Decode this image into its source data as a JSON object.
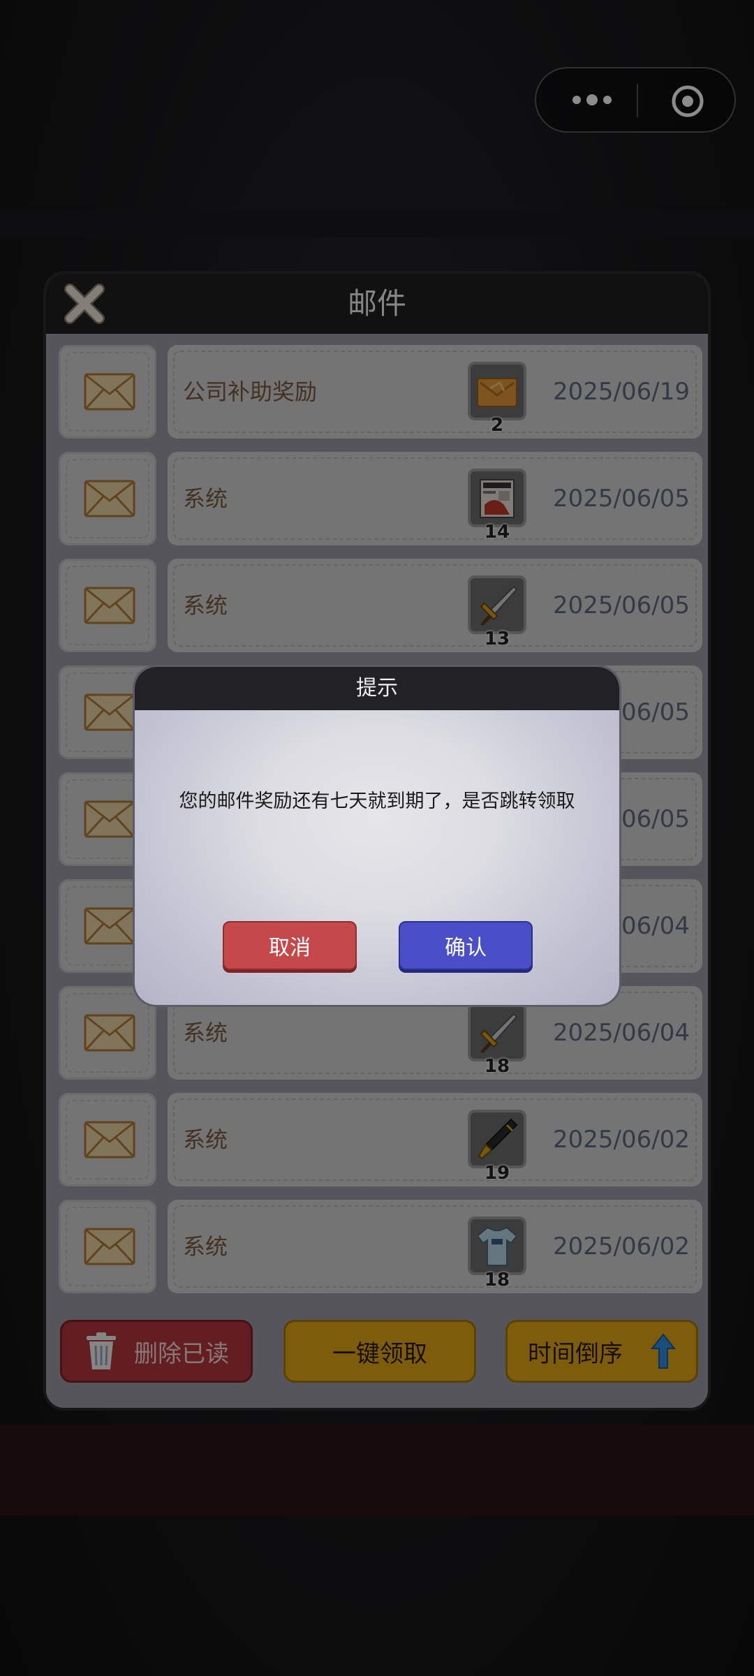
{
  "panel": {
    "title": "邮件"
  },
  "mails": [
    {
      "title": "公司补助奖励",
      "item_icon": "envelope-card-icon",
      "count": "2",
      "date": "2025/06/19"
    },
    {
      "title": "系统",
      "item_icon": "newspaper-icon",
      "count": "14",
      "date": "2025/06/05"
    },
    {
      "title": "系统",
      "item_icon": "dagger-icon",
      "count": "13",
      "date": "2025/06/05"
    },
    {
      "title": "",
      "item_icon": "",
      "count": "",
      "date": "2025/06/05"
    },
    {
      "title": "",
      "item_icon": "",
      "count": "",
      "date": "2025/06/05"
    },
    {
      "title": "",
      "item_icon": "",
      "count": "",
      "date": "2025/06/04"
    },
    {
      "title": "系统",
      "item_icon": "dagger-icon",
      "count": "18",
      "date": "2025/06/04"
    },
    {
      "title": "系统",
      "item_icon": "fountain-pen-icon",
      "count": "19",
      "date": "2025/06/02"
    },
    {
      "title": "系统",
      "item_icon": "tshirt-icon",
      "count": "18",
      "date": "2025/06/02"
    }
  ],
  "buttons": {
    "delete_read": "删除已读",
    "claim_all": "一键领取",
    "sort": "时间倒序"
  },
  "dialog": {
    "title": "提示",
    "message": "您的邮件奖励还有七天就到期了，是否跳转领取",
    "cancel": "取消",
    "confirm": "确认"
  },
  "colors": {
    "cancel_red": "#c5494b",
    "confirm_blue": "#4a4fc8",
    "gold": "#e3a917",
    "delete_red": "#b5383c"
  }
}
